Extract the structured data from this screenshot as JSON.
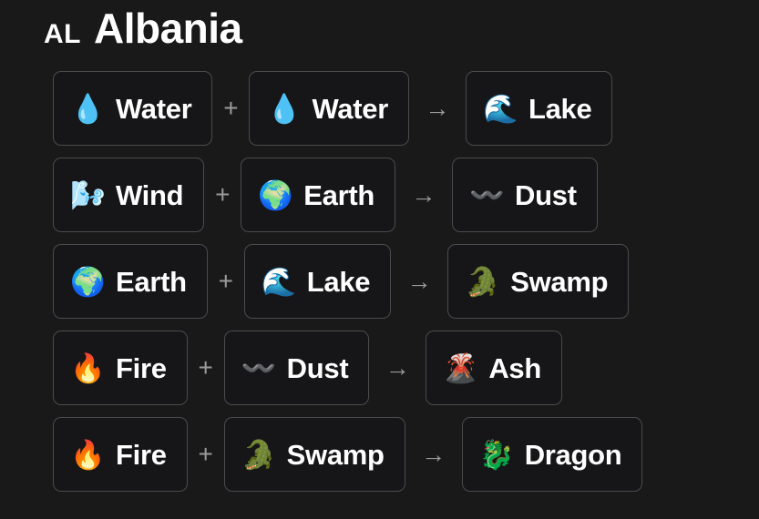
{
  "header": {
    "country_code": "AL",
    "country_name": "Albania"
  },
  "operators": {
    "plus": "+",
    "arrow": "→"
  },
  "colors": {
    "background": "#191919",
    "card_background": "#161618",
    "card_border": "#4b4b4e",
    "text": "#ffffff",
    "operator": "#9a9a9a"
  },
  "recipes": [
    {
      "input_a": {
        "label": "Water",
        "emoji": "💧",
        "icon": "water-droplet-icon"
      },
      "input_b": {
        "label": "Water",
        "emoji": "💧",
        "icon": "water-droplet-icon"
      },
      "output": {
        "label": "Lake",
        "emoji": "🌊",
        "icon": "water-wave-icon"
      }
    },
    {
      "input_a": {
        "label": "Wind",
        "emoji": "🌬️",
        "icon": "wind-face-icon"
      },
      "input_b": {
        "label": "Earth",
        "emoji": "🌍",
        "icon": "globe-europe-africa-icon"
      },
      "output": {
        "label": "Dust",
        "emoji": "〰️",
        "icon": "wavy-dash-icon"
      }
    },
    {
      "input_a": {
        "label": "Earth",
        "emoji": "🌍",
        "icon": "globe-europe-africa-icon"
      },
      "input_b": {
        "label": "Lake",
        "emoji": "🌊",
        "icon": "water-wave-icon"
      },
      "output": {
        "label": "Swamp",
        "emoji": "🐊",
        "icon": "crocodile-icon"
      }
    },
    {
      "input_a": {
        "label": "Fire",
        "emoji": "🔥",
        "icon": "fire-icon"
      },
      "input_b": {
        "label": "Dust",
        "emoji": "〰️",
        "icon": "wavy-dash-icon"
      },
      "output": {
        "label": "Ash",
        "emoji": "🌋",
        "icon": "volcano-icon"
      }
    },
    {
      "input_a": {
        "label": "Fire",
        "emoji": "🔥",
        "icon": "fire-icon"
      },
      "input_b": {
        "label": "Swamp",
        "emoji": "🐊",
        "icon": "crocodile-icon"
      },
      "output": {
        "label": "Dragon",
        "emoji": "🐉",
        "icon": "dragon-icon"
      }
    }
  ]
}
